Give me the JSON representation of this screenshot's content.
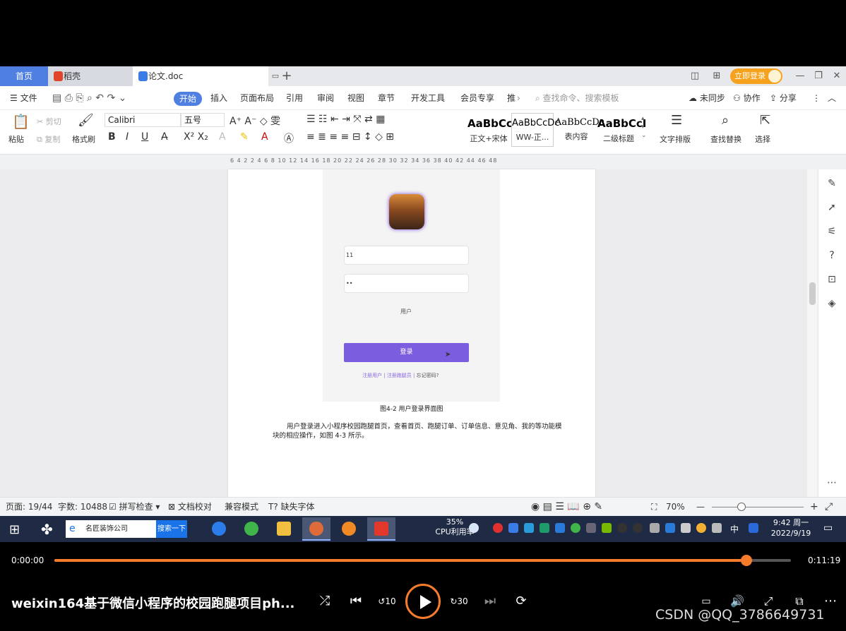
{
  "tabs": {
    "home": "首页",
    "daoke": "稻壳",
    "doc": "论文.doc",
    "login": "立即登录"
  },
  "menu": {
    "file": "文件",
    "items": [
      "开始",
      "插入",
      "页面布局",
      "引用",
      "审阅",
      "视图",
      "章节",
      "开发工具",
      "会员专享",
      "推"
    ],
    "search_placeholder": "查找命令、搜索模板",
    "sync": "未同步",
    "collab": "协作",
    "share": "分享"
  },
  "ribbon": {
    "paste": "粘贴",
    "cut": "剪切",
    "copy": "复制",
    "format_painter": "格式刷",
    "font": "Calibri",
    "size": "五号",
    "styles": [
      {
        "preview": "AaBbCc",
        "label": "正文+宋体"
      },
      {
        "preview": "AaBbCcDc",
        "label": "WW-正..."
      },
      {
        "preview": "AaBbCcDc",
        "label": "表内容"
      },
      {
        "preview": "AaBbCcI",
        "label": "二级标题"
      }
    ],
    "text_layout": "文字排版",
    "find_replace": "查找替换",
    "select": "选择"
  },
  "ruler": "6 4 2 2 4 6 8 10 12 14 16 18 20 22 24 26 28 30 32 34 36 38 40 42 44 46 48",
  "document": {
    "field_user": "11",
    "field_password": "••",
    "role": "用户",
    "login_button": "登录",
    "link_register_user": "注册用户",
    "link_register_runner": "注册跑腿员",
    "link_forgot": "忘记密码?",
    "caption": "图4-2 用户登录界面图",
    "paragraph": "用户登录进入小程序校园跑腿首页，查看首页、跑腿订单、订单信息、意见角、我的等功能模块的相应操作，如图 4-3 所示。"
  },
  "status": {
    "page": "页面: 19/44",
    "words": "字数: 10488",
    "spell": "拼写检查",
    "proof": "文档校对",
    "compat": "兼容模式",
    "missing_font": "缺失字体",
    "zoom": "70%"
  },
  "taskbar": {
    "search_text": "名匠装饰公司",
    "search_btn": "搜索一下",
    "cpu_percent": "35%",
    "cpu_label": "CPU利用率",
    "time": "9:42 周一",
    "date": "2022/9/19",
    "ime": "中"
  },
  "player": {
    "current": "0:00:00",
    "total": "0:11:19",
    "progress": 0.94,
    "title": "weixin164基于微信小程序的校园跑腿项目ph...",
    "skip_back": "10",
    "skip_fwd": "30"
  },
  "watermark": "CSDN @QQ_3786649731",
  "colors": {
    "accent": "#4f7fe0",
    "login_purple": "#7b5ee0",
    "progress_orange": "#f57c2b"
  }
}
